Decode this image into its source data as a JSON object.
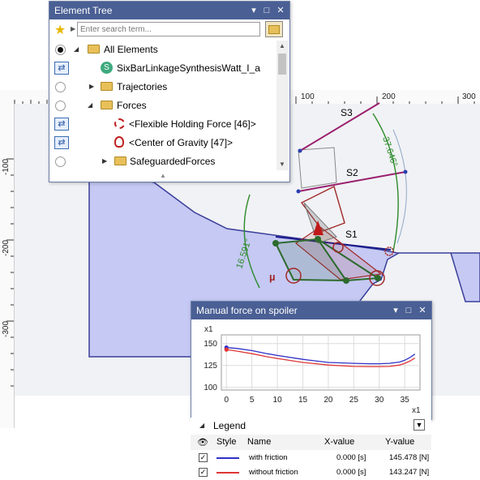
{
  "ruler": {
    "top_labels": [
      "100",
      "200",
      "300"
    ],
    "left_labels": [
      "-100",
      "-200",
      "-300"
    ]
  },
  "drawing": {
    "labels": {
      "s3": "S3",
      "s2": "S2",
      "s1": "S1",
      "angle1": "37.646°",
      "angle2": "16.591°",
      "mu": "µ"
    },
    "colors": {
      "body": "#c5c9f3",
      "body_stroke": "#3a3f9a",
      "linkage": "#2d6a2d",
      "force": "#b11f1f",
      "angle": "#2b8a2b",
      "slot": "#9a1f6e"
    }
  },
  "element_tree": {
    "title": "Element Tree",
    "search_placeholder": "Enter search term...",
    "items": [
      {
        "label": "All Elements",
        "control": "radio-on",
        "icon": "folder-icon"
      },
      {
        "label": "SixBarLinkageSynthesisWatt_I_a",
        "control": "swap",
        "icon": "synthesis-icon"
      },
      {
        "label": "Trajectories",
        "control": "radio",
        "icon": "folder-icon"
      },
      {
        "label": "Forces",
        "control": "radio",
        "icon": "folder-icon"
      },
      {
        "label": "<Flexible Holding Force [46]>",
        "control": "swap",
        "icon": "force-target-icon"
      },
      {
        "label": "<Center of Gravity [47]>",
        "control": "swap",
        "icon": "gravity-icon"
      },
      {
        "label": "SafeguardedForces",
        "control": "radio",
        "icon": "folder-icon"
      }
    ]
  },
  "force_panel": {
    "title": "Manual force on spoiler",
    "legend_title": "Legend",
    "columns": [
      "Style",
      "Name",
      "X-value",
      "Y-value"
    ],
    "rows": [
      {
        "name": "with friction",
        "x": "0.000 [s]",
        "y": "145.478 [N]",
        "color": "#3030c8"
      },
      {
        "name": "without friction",
        "x": "0.000 [s]",
        "y": "143.247 [N]",
        "color": "#e03535"
      }
    ]
  },
  "chart_data": {
    "type": "line",
    "title": "",
    "xlabel": "x1",
    "ylabel": "x1",
    "xlim": [
      -1,
      38
    ],
    "ylim": [
      97,
      160
    ],
    "x_ticks": [
      0,
      5,
      10,
      15,
      20,
      25,
      30,
      35
    ],
    "y_ticks": [
      100,
      125,
      150
    ],
    "grid": true,
    "series": [
      {
        "name": "with friction",
        "color": "#3030c8",
        "x": [
          0,
          2,
          5,
          8,
          10,
          15,
          20,
          25,
          28,
          30,
          32,
          34,
          35,
          36,
          37
        ],
        "y": [
          145.5,
          144.5,
          142.0,
          138.5,
          136.5,
          132.0,
          128.5,
          127.5,
          127.0,
          127.0,
          127.5,
          129.0,
          131.0,
          134.0,
          138.0
        ]
      },
      {
        "name": "without friction",
        "color": "#e03535",
        "x": [
          0,
          2,
          5,
          8,
          10,
          15,
          20,
          25,
          28,
          30,
          32,
          34,
          35,
          36,
          37
        ],
        "y": [
          143.2,
          141.5,
          138.5,
          135.0,
          133.0,
          128.5,
          125.5,
          124.0,
          123.8,
          123.8,
          124.0,
          125.5,
          127.5,
          130.0,
          133.5
        ]
      }
    ]
  }
}
